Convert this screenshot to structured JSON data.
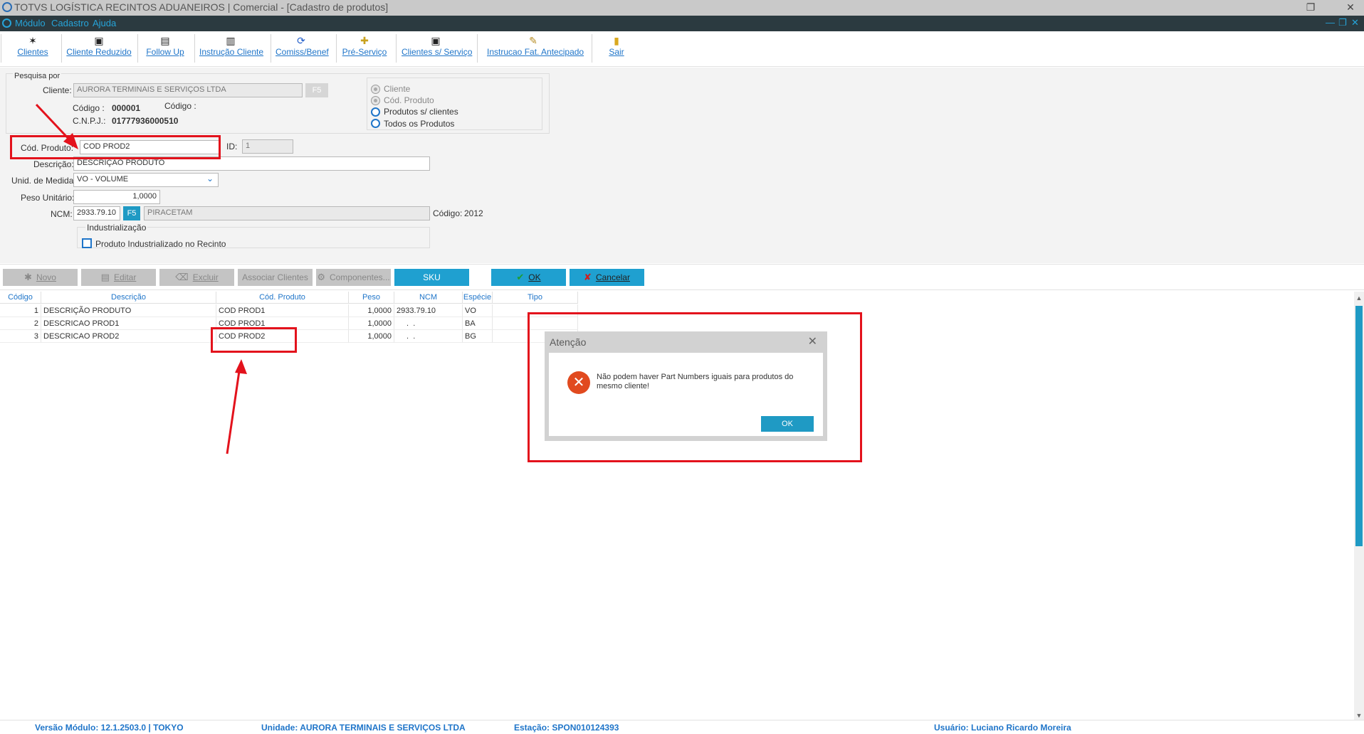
{
  "window": {
    "title": "TOTVS LOGÍSTICA RECINTOS ADUANEIROS | Comercial - [Cadastro de produtos]"
  },
  "menu": {
    "items": [
      "Módulo",
      "Cadastro",
      "Ajuda"
    ]
  },
  "toolbar": {
    "buttons": [
      {
        "label": "Clientes",
        "icon": "clients-icon"
      },
      {
        "label": "Cliente Reduzido",
        "icon": "reduced-client-icon"
      },
      {
        "label": "Follow Up",
        "icon": "follow-up-icon"
      },
      {
        "label": "Instrução Cliente",
        "icon": "client-instruction-icon"
      },
      {
        "label": "Comiss/Benef",
        "icon": "refresh-icon"
      },
      {
        "label": "Pré-Serviço",
        "icon": "pre-service-icon"
      },
      {
        "label": "Clientes s/ Serviço",
        "icon": "clients-no-service-icon"
      },
      {
        "label": "Instrucao Fat. Antecipado",
        "icon": "advance-billing-icon"
      },
      {
        "label": "Sair",
        "icon": "exit-icon"
      }
    ]
  },
  "search": {
    "title": "Pesquisa por",
    "cliente_label": "Cliente:",
    "cliente_value": "AURORA TERMINAIS E SERVIÇOS LTDA",
    "f5": "F5",
    "codigo_label": "Código :",
    "codigo_value": "000001",
    "codigo2_label": "Código :",
    "cnpj_label": "C.N.P.J.:",
    "cnpj_value": "01777936000510",
    "options": [
      {
        "label": "Cliente",
        "state": "disabled-selected"
      },
      {
        "label": "Cód. Produto",
        "state": "disabled"
      },
      {
        "label": "Produtos s/ clientes",
        "state": "enabled"
      },
      {
        "label": "Todos os Produtos",
        "state": "enabled"
      }
    ]
  },
  "form": {
    "cod_produto_label": "Cód. Produto:",
    "cod_produto_value": "COD PROD2",
    "id_label": "ID:",
    "id_value": "1",
    "descricao_label": "Descrição:",
    "descricao_value": "DESCRIÇÃO PRODUTO",
    "unid_label": "Unid. de Medida:",
    "unid_value": "VO - VOLUME",
    "peso_label": "Peso Unitário:",
    "peso_value": "1,0000",
    "ncm_label": "NCM:",
    "ncm_value": "2933.79.10",
    "ncm_f5": "F5",
    "ncm_desc": "PIRACETAM",
    "ncm_codigo_label": "Código:",
    "ncm_codigo_value": "2012",
    "industrializacao_title": "Industrialização",
    "industrializado_label": "Produto Industrializado no Recinto"
  },
  "actions": {
    "novo": "Novo",
    "editar": "Editar",
    "excluir": "Excluir",
    "associar": "Associar Clientes",
    "componentes": "Componentes...",
    "sku": "SKU",
    "ok": "OK",
    "cancelar": "Cancelar"
  },
  "grid": {
    "headers": [
      "Código",
      "Descrição",
      "Cód. Produto",
      "Peso",
      "NCM",
      "Espécie",
      "Tipo"
    ],
    "rows": [
      [
        "1",
        "DESCRIÇÃO PRODUTO",
        "COD PROD1",
        "1,0000",
        "2933.79.10",
        "VO",
        ""
      ],
      [
        "2",
        "DESCRICAO PROD1",
        "COD PROD1",
        "1,0000",
        " .  . ",
        "BA",
        ""
      ],
      [
        "3",
        "DESCRICAO PROD2",
        "COD PROD2",
        "1,0000",
        " .  . ",
        "BG",
        ""
      ]
    ]
  },
  "dialog": {
    "title": "Atenção",
    "message": "Não podem haver Part Numbers iguais para produtos do mesmo cliente!",
    "ok": "OK"
  },
  "status": {
    "versao": "Versão Módulo:  12.1.2503.0  |  TOKYO",
    "unidade": "Unidade: AURORA TERMINAIS E SERVIÇOS LTDA",
    "estacao": "Estação: SPON010124393",
    "usuario": "Usuário: Luciano Ricardo Moreira"
  },
  "colors": {
    "accent": "#1f9ac4",
    "link": "#1f75c9",
    "menubar": "#2b3a40",
    "annotation": "#e3121c",
    "error": "#e14a1f"
  }
}
